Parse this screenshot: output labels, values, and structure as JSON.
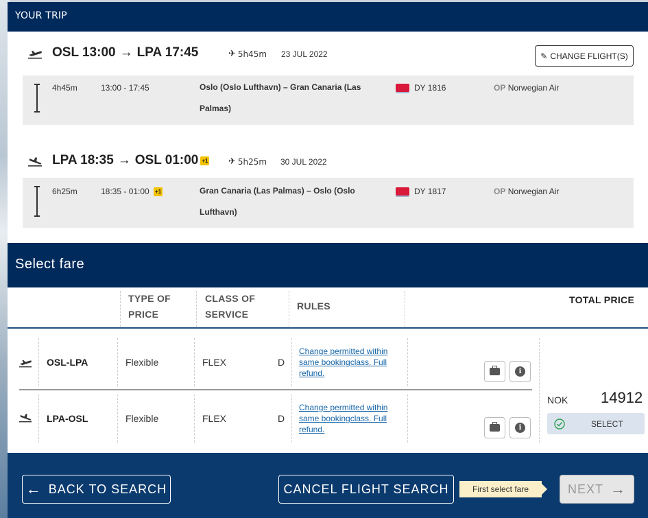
{
  "trip": {
    "header": "YOUR TRIP",
    "change_button": "CHANGE FLIGHT(S)",
    "outbound": {
      "title_from": "OSL 13:00",
      "title_to": "LPA 17:45",
      "duration": "5h45m",
      "date": "23 JUL 2022",
      "segment": {
        "duration": "4h45m",
        "times": "13:00 - 17:45",
        "route_line1": "Oslo (Oslo Lufthavn) – Gran Canaria (Las",
        "route_line2": "Palmas)",
        "flight_no": "DY 1816",
        "op_label": "OP",
        "operator": "Norwegian Air"
      }
    },
    "inbound": {
      "title_from": "LPA 18:35",
      "title_to": "OSL 01:00",
      "plus_day": "+1",
      "duration": "5h25m",
      "date": "30 JUL 2022",
      "segment": {
        "duration": "6h25m",
        "times": "18:35 - 01:00",
        "plus_day": "+1",
        "route_line1": "Gran Canaria (Las Palmas) – Oslo (Oslo",
        "route_line2": "Lufthavn)",
        "flight_no": "DY 1817",
        "op_label": "OP",
        "operator": "Norwegian Air"
      }
    }
  },
  "fare": {
    "header": "Select fare",
    "columns": {
      "type_line1": "TYPE OF",
      "type_line2": "PRICE",
      "class_line1": "CLASS OF",
      "class_line2": "SERVICE",
      "rules": "RULES",
      "total": "TOTAL PRICE"
    },
    "rows": [
      {
        "route": "OSL-LPA",
        "type": "Flexible",
        "class": "FLEX",
        "booking_class": "D",
        "rules_line1": "Change permitted within",
        "rules_line2": "same bookingclass. Full",
        "rules_line3": "refund."
      },
      {
        "route": "LPA-OSL",
        "type": "Flexible",
        "class": "FLEX",
        "booking_class": "D",
        "rules_line1": "Change permitted within",
        "rules_line2": "same bookingclass. Full",
        "rules_line3": "refund."
      }
    ],
    "currency": "NOK",
    "price": "14912",
    "select_label": "SELECT"
  },
  "footer": {
    "back": "BACK TO SEARCH",
    "cancel": "CANCEL FLIGHT SEARCH",
    "tooltip": "First select fare",
    "next": "NEXT"
  },
  "colors": {
    "navy": "#002a5c",
    "footer_blue": "#0b3a6e",
    "link": "#1565a8",
    "badge_yellow": "#f3c200"
  }
}
